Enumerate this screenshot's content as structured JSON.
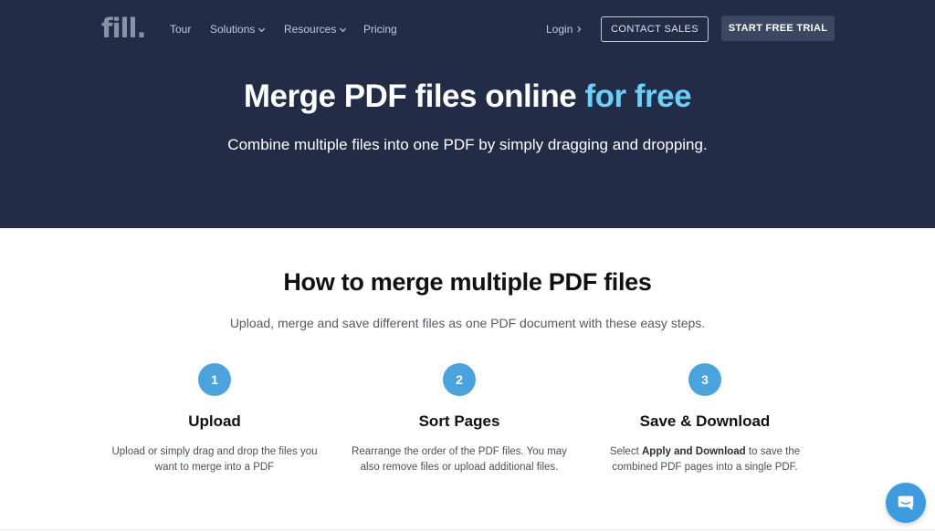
{
  "nav": {
    "logo": "fill.",
    "links": [
      {
        "label": "Tour"
      },
      {
        "label": "Solutions"
      },
      {
        "label": "Resources"
      },
      {
        "label": "Pricing"
      }
    ],
    "login": "Login",
    "contact_sales": "CONTACT SALES",
    "start_trial": "START FREE TRIAL"
  },
  "hero": {
    "title_main": "Merge PDF files online ",
    "title_accent": "for free",
    "subtitle": "Combine multiple files into one PDF by simply dragging and dropping."
  },
  "howto": {
    "title": "How to merge multiple PDF files",
    "subtitle": "Upload, merge and save different files as one PDF document with these easy steps.",
    "steps": [
      {
        "number": "1",
        "title": "Upload",
        "desc_line1": "Upload or simply drag and drop the files you",
        "desc_line2": "want to merge into a PDF"
      },
      {
        "number": "2",
        "title": "Sort Pages",
        "desc_line1": "Rearrange the order of the PDF files. You may",
        "desc_line2": "also remove files or upload additional files."
      },
      {
        "number": "3",
        "title": "Save & Download",
        "desc_pre": "Select ",
        "desc_bold": "Apply and Download",
        "desc_post": " to save the",
        "desc_line2": "combined PDF pages into a single PDF."
      }
    ]
  },
  "colors": {
    "hero_bg": "#222c47",
    "accent": "#6ad0f7",
    "step_circle": "#4aa3dc",
    "chat_button": "#3d9be0"
  },
  "icons": {
    "dropdown": "chevron-down-icon",
    "login_arrow": "chevron-right-icon",
    "chat": "chat-bubble-icon"
  }
}
